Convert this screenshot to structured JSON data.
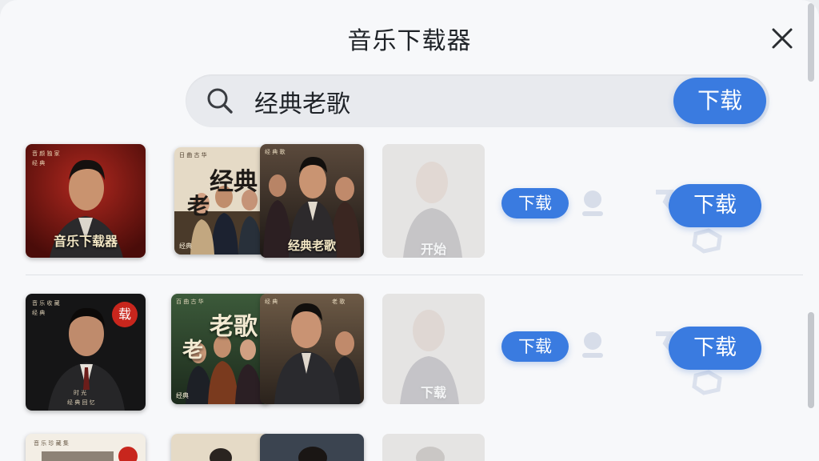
{
  "window": {
    "title": "音乐下载器"
  },
  "search": {
    "query": "经典老歌",
    "download_label": "下载"
  },
  "results": [
    {
      "cover_1_caption": "音乐下载器",
      "cover_2_title_top": "经典",
      "cover_2_title_side": "老",
      "cover_3_caption": "经典老歌",
      "cover_4_caption": "开始",
      "small_button": "下载",
      "large_button": "下载"
    },
    {
      "cover_1_badge": "载",
      "cover_2_title_top": "老歌",
      "cover_2_title_side": "老",
      "cover_4_caption": "下载",
      "small_button": "下载",
      "large_button": "下载"
    }
  ],
  "colors": {
    "accent": "#3a7be0",
    "background": "#f7f8fa",
    "search_bg": "#e8eaee"
  }
}
